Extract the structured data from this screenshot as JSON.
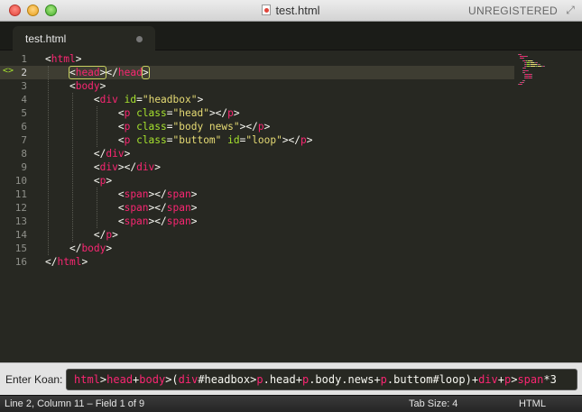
{
  "window": {
    "title": "test.html",
    "license_status": "UNREGISTERED",
    "icons": [
      "close-button",
      "minimize-button",
      "zoom-button",
      "file-icon",
      "fullscreen-icon"
    ]
  },
  "tabs": [
    {
      "label": "test.html",
      "dirty": true
    }
  ],
  "editor": {
    "current_line": 2,
    "line_numbers": [
      "1",
      "2",
      "3",
      "4",
      "5",
      "6",
      "7",
      "8",
      "9",
      "10",
      "11",
      "12",
      "13",
      "14",
      "15",
      "16"
    ],
    "lines": [
      {
        "indent": 0,
        "tokens": [
          [
            "b",
            "<"
          ],
          [
            "t",
            "html"
          ],
          [
            "b",
            ">"
          ]
        ]
      },
      {
        "indent": 1,
        "tokens": [
          [
            "h",
            "<head>"
          ],
          [
            "b",
            "</"
          ],
          [
            "t",
            "head"
          ],
          [
            "h2",
            ">"
          ]
        ]
      },
      {
        "indent": 1,
        "tokens": [
          [
            "b",
            "<"
          ],
          [
            "t",
            "body"
          ],
          [
            "b",
            ">"
          ]
        ]
      },
      {
        "indent": 2,
        "tokens": [
          [
            "b",
            "<"
          ],
          [
            "t",
            "div"
          ],
          [
            "b",
            " "
          ],
          [
            "a",
            "id"
          ],
          [
            "b",
            "="
          ],
          [
            "s",
            "\"headbox\""
          ],
          [
            "b",
            ">"
          ]
        ]
      },
      {
        "indent": 3,
        "tokens": [
          [
            "b",
            "<"
          ],
          [
            "t",
            "p"
          ],
          [
            "b",
            " "
          ],
          [
            "a",
            "class"
          ],
          [
            "b",
            "="
          ],
          [
            "s",
            "\"head\""
          ],
          [
            "b",
            "></"
          ],
          [
            "t",
            "p"
          ],
          [
            "b",
            ">"
          ]
        ]
      },
      {
        "indent": 3,
        "tokens": [
          [
            "b",
            "<"
          ],
          [
            "t",
            "p"
          ],
          [
            "b",
            " "
          ],
          [
            "a",
            "class"
          ],
          [
            "b",
            "="
          ],
          [
            "s",
            "\"body news\""
          ],
          [
            "b",
            "></"
          ],
          [
            "t",
            "p"
          ],
          [
            "b",
            ">"
          ]
        ]
      },
      {
        "indent": 3,
        "tokens": [
          [
            "b",
            "<"
          ],
          [
            "t",
            "p"
          ],
          [
            "b",
            " "
          ],
          [
            "a",
            "class"
          ],
          [
            "b",
            "="
          ],
          [
            "s",
            "\"buttom\""
          ],
          [
            "b",
            " "
          ],
          [
            "a",
            "id"
          ],
          [
            "b",
            "="
          ],
          [
            "s",
            "\"loop\""
          ],
          [
            "b",
            "></"
          ],
          [
            "t",
            "p"
          ],
          [
            "b",
            ">"
          ]
        ]
      },
      {
        "indent": 2,
        "tokens": [
          [
            "b",
            "</"
          ],
          [
            "t",
            "div"
          ],
          [
            "b",
            ">"
          ]
        ]
      },
      {
        "indent": 2,
        "tokens": [
          [
            "b",
            "<"
          ],
          [
            "t",
            "div"
          ],
          [
            "b",
            "></"
          ],
          [
            "t",
            "div"
          ],
          [
            "b",
            ">"
          ]
        ]
      },
      {
        "indent": 2,
        "tokens": [
          [
            "b",
            "<"
          ],
          [
            "t",
            "p"
          ],
          [
            "b",
            ">"
          ]
        ]
      },
      {
        "indent": 3,
        "tokens": [
          [
            "b",
            "<"
          ],
          [
            "t",
            "span"
          ],
          [
            "b",
            "></"
          ],
          [
            "t",
            "span"
          ],
          [
            "b",
            ">"
          ]
        ]
      },
      {
        "indent": 3,
        "tokens": [
          [
            "b",
            "<"
          ],
          [
            "t",
            "span"
          ],
          [
            "b",
            "></"
          ],
          [
            "t",
            "span"
          ],
          [
            "b",
            ">"
          ]
        ]
      },
      {
        "indent": 3,
        "tokens": [
          [
            "b",
            "<"
          ],
          [
            "t",
            "span"
          ],
          [
            "b",
            "></"
          ],
          [
            "t",
            "span"
          ],
          [
            "b",
            ">"
          ]
        ]
      },
      {
        "indent": 2,
        "tokens": [
          [
            "b",
            "</"
          ],
          [
            "t",
            "p"
          ],
          [
            "b",
            ">"
          ]
        ]
      },
      {
        "indent": 1,
        "tokens": [
          [
            "b",
            "</"
          ],
          [
            "t",
            "body"
          ],
          [
            "b",
            ">"
          ]
        ]
      },
      {
        "indent": 0,
        "tokens": [
          [
            "b",
            "</"
          ],
          [
            "t",
            "html"
          ],
          [
            "b",
            ">"
          ]
        ]
      }
    ]
  },
  "koan": {
    "label": "Enter Koan:",
    "tokens": [
      [
        "t",
        "html"
      ],
      [
        "b",
        ">"
      ],
      [
        "t",
        "head"
      ],
      [
        "b",
        "+"
      ],
      [
        "t",
        "body"
      ],
      [
        "b",
        ">("
      ],
      [
        "t",
        "div"
      ],
      [
        "b",
        "#headbox"
      ],
      [
        "b",
        ">"
      ],
      [
        "t",
        "p"
      ],
      [
        "b",
        ".head"
      ],
      [
        "b",
        "+"
      ],
      [
        "t",
        "p"
      ],
      [
        "b",
        ".body.news"
      ],
      [
        "b",
        "+"
      ],
      [
        "t",
        "p"
      ],
      [
        "b",
        ".buttom#loop)"
      ],
      [
        "b",
        "+"
      ],
      [
        "t",
        "div"
      ],
      [
        "b",
        "+"
      ],
      [
        "t",
        "p"
      ],
      [
        "b",
        ">"
      ],
      [
        "t",
        "span"
      ],
      [
        "b",
        "*3"
      ]
    ]
  },
  "status": {
    "position": "Line 2, Column 11 – Field 1 of 9",
    "tab_size": "Tab Size: 4",
    "syntax": "HTML"
  },
  "colors": {
    "background": "#272822",
    "tag": "#f92672",
    "attribute": "#a6e22e",
    "string": "#e6db74",
    "text": "#f8f8f2"
  }
}
